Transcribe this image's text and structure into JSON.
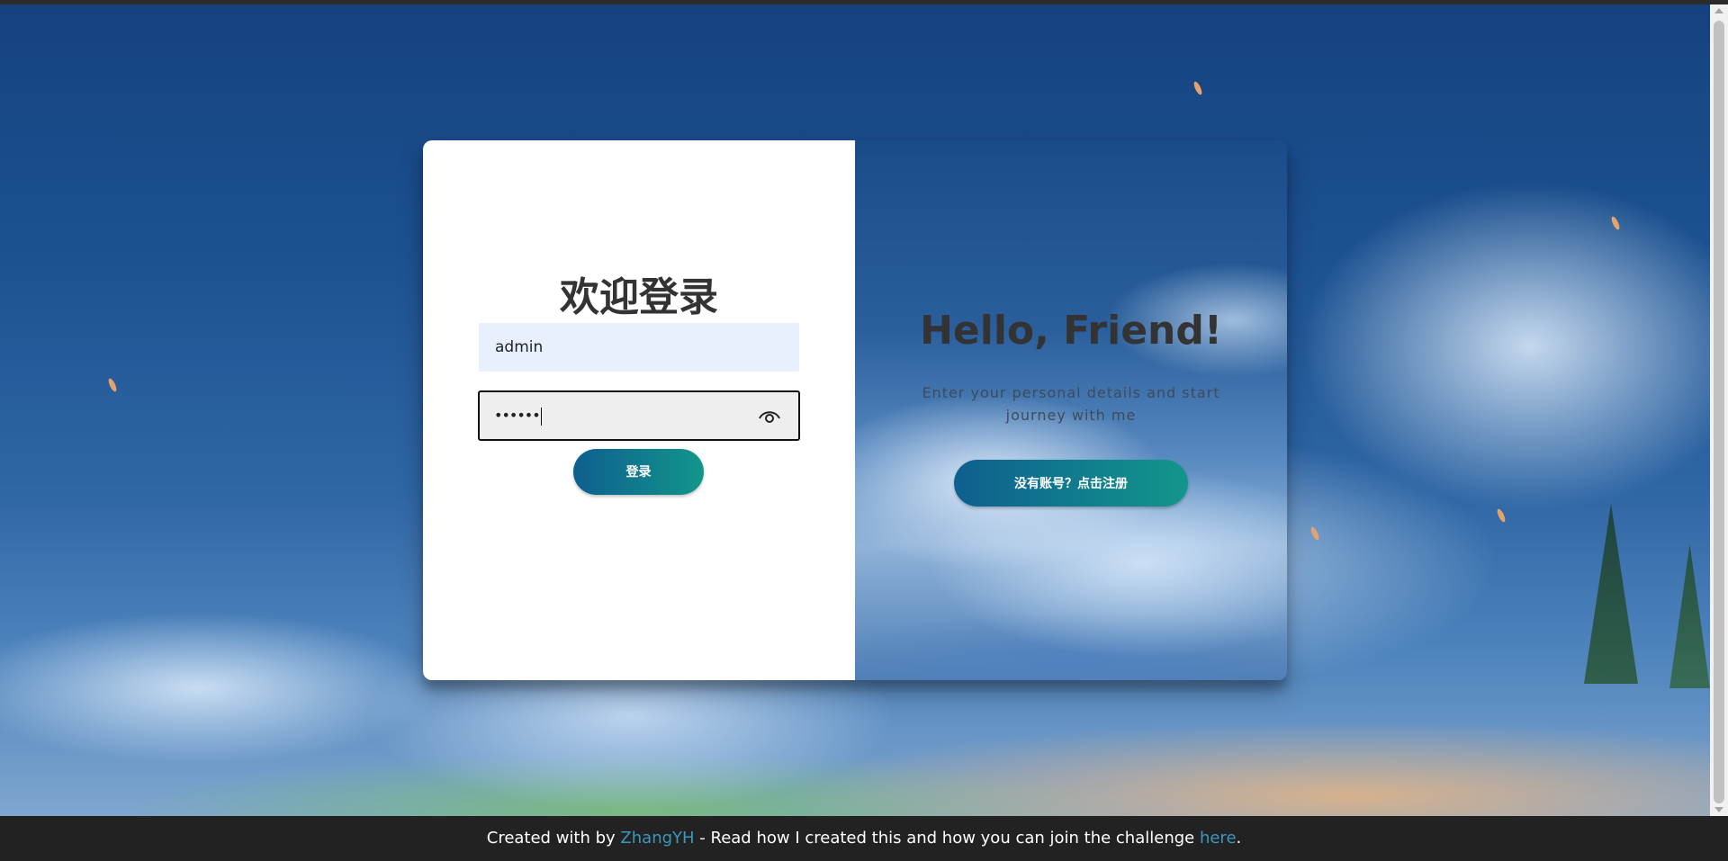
{
  "login_form": {
    "title": "欢迎登录",
    "username_value": "admin",
    "password_value": "••••••",
    "login_button": "登录"
  },
  "overlay": {
    "title": "Hello, Friend!",
    "text": "Enter your personal details and start journey with me",
    "register_button": "没有账号？点击注册"
  },
  "footer": {
    "prefix": "Created with by ",
    "author": "ZhangYH",
    "middle": " - Read how I created this and how you can join the challenge ",
    "link": "here",
    "suffix": "."
  },
  "icons": {
    "password_toggle": "eye-icon"
  },
  "colors": {
    "button_gradient_start": "#0e5f8f",
    "button_gradient_end": "#12968b",
    "username_field_bg": "#e8f0fe",
    "footer_bg": "#222222",
    "footer_link": "#3c97bf"
  }
}
